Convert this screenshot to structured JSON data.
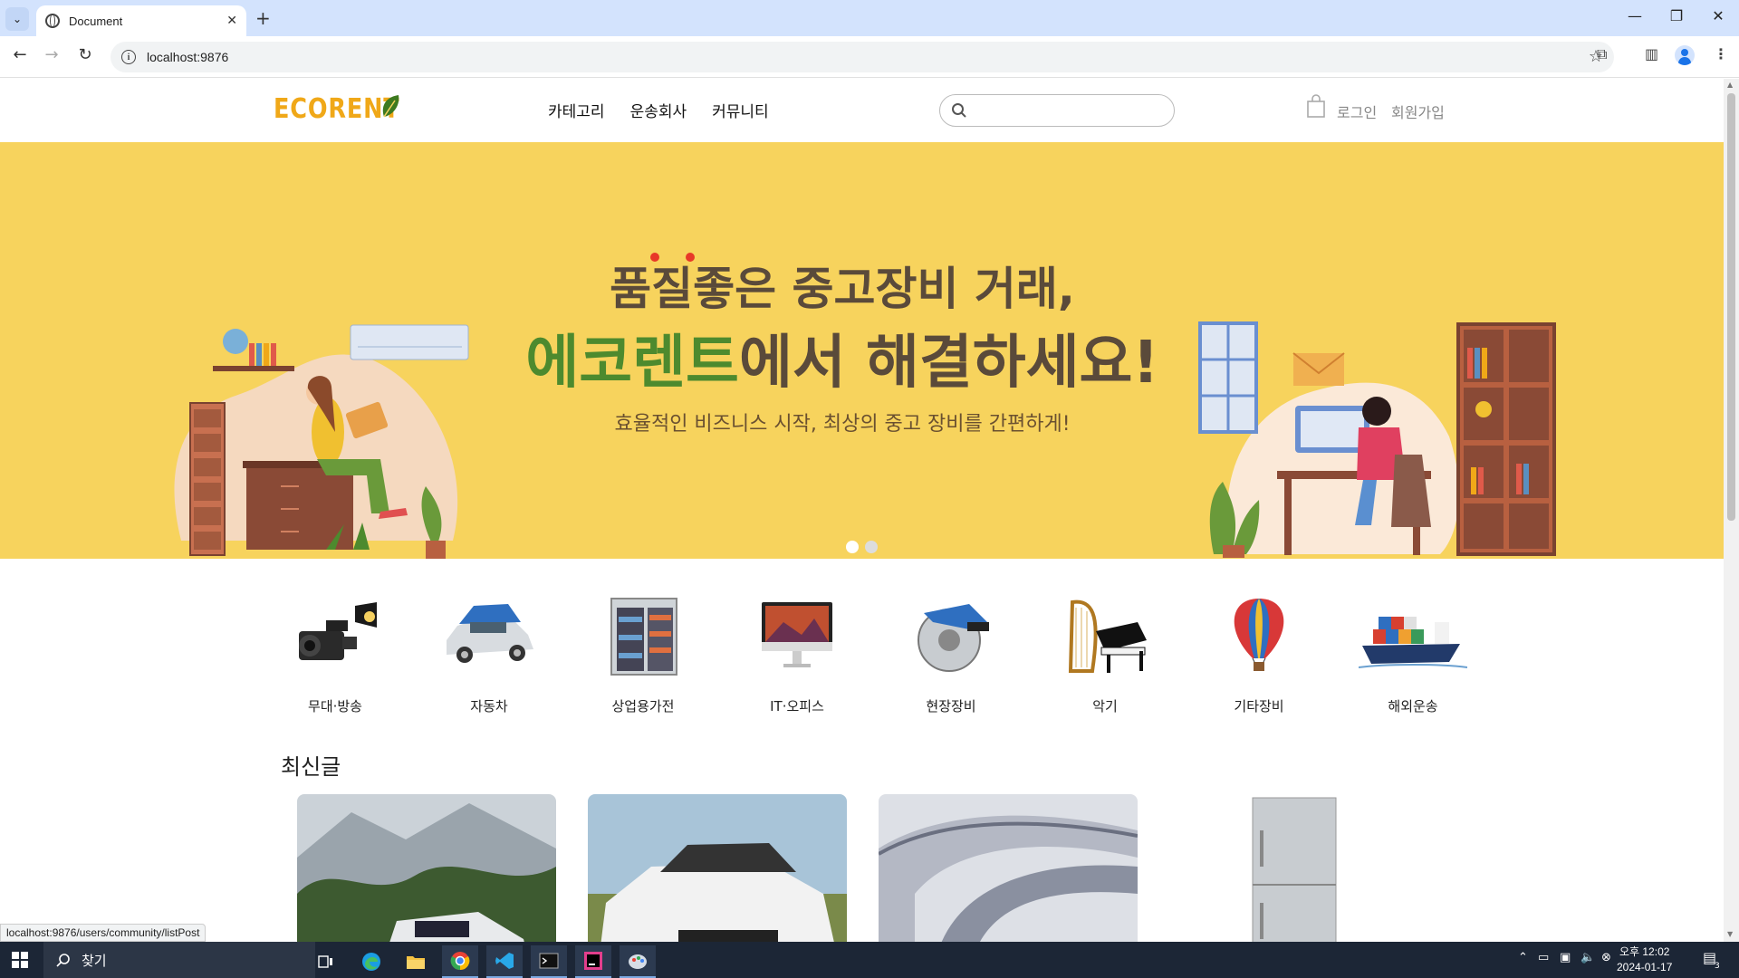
{
  "browser": {
    "tab_title": "Document",
    "url": "localhost:9876",
    "status_url": "localhost:9876/users/community/listPost"
  },
  "site": {
    "logo": "ECORENT",
    "nav": [
      "카테고리",
      "운송회사",
      "커뮤니티"
    ],
    "search_placeholder": "",
    "login": "로그인",
    "signup": "회원가입"
  },
  "hero": {
    "line1": "품질좋은 중고장비 거래,",
    "line2_highlight": "에코렌트",
    "line2_rest": "에서 해결하세요!",
    "subtitle": "효율적인 비즈니스 시작, 최상의 중고 장비를 간편하게!",
    "slide_count": 2,
    "active_slide": 1
  },
  "categories": [
    {
      "label": "무대·방송",
      "icon": "camera-icon"
    },
    {
      "label": "자동차",
      "icon": "car-icon"
    },
    {
      "label": "상업용가전",
      "icon": "fridge-icon"
    },
    {
      "label": "IT·오피스",
      "icon": "monitor-icon"
    },
    {
      "label": "현장장비",
      "icon": "saw-icon"
    },
    {
      "label": "악기",
      "icon": "piano-icon"
    },
    {
      "label": "기타장비",
      "icon": "balloon-icon"
    },
    {
      "label": "해외운송",
      "icon": "ship-icon"
    }
  ],
  "latest": {
    "title": "최신글"
  },
  "taskbar": {
    "search_label": "찾기",
    "time": "오후 12:02",
    "date": "2024-01-17",
    "notifications": "3"
  },
  "colors": {
    "hero_bg": "#f7d35d",
    "logo": "#f0a818",
    "brand_green": "#4d8a2e"
  }
}
